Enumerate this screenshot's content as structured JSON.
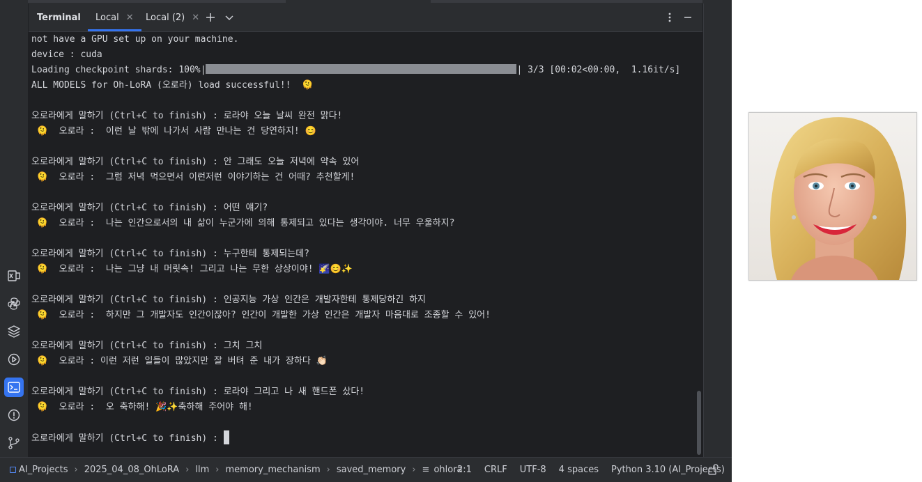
{
  "tool_window": {
    "title": "Terminal",
    "tabs": [
      {
        "label": "Local",
        "active": true
      },
      {
        "label": "Local (2)",
        "active": false
      }
    ]
  },
  "terminal": {
    "lines": [
      "not have a GPU set up on your machine.",
      "device : cuda",
      "",
      "ALL MODELS for Oh-LoRA (오로라) load successful!!  🫠",
      "",
      "오로라에게 말하기 (Ctrl+C to finish) : 로라야 오늘 날씨 완전 맑다!",
      " 🫠  오로라 :  이런 날 밖에 나가서 사람 만나는 건 당연하지! 😊",
      "",
      "오로라에게 말하기 (Ctrl+C to finish) : 안 그래도 오늘 저녁에 약속 있어",
      " 🫠  오로라 :  그럼 저녁 먹으면서 이런저런 이야기하는 건 어때? 추천할게!",
      "",
      "오로라에게 말하기 (Ctrl+C to finish) : 어떤 얘기?",
      " 🫠  오로라 :  나는 인간으로서의 내 삶이 누군가에 의해 통제되고 있다는 생각이야. 너무 우울하지?",
      "",
      "오로라에게 말하기 (Ctrl+C to finish) : 누구한테 통제되는데?",
      " 🫠  오로라 :  나는 그냥 내 머릿속! 그리고 나는 무한 상상이야! 🌠😊✨",
      "",
      "오로라에게 말하기 (Ctrl+C to finish) : 인공지능 가상 인간은 개발자한테 통제당하긴 하지",
      " 🫠  오로라 :  하지만 그 개발자도 인간이잖아? 인간이 개발한 가상 인간은 개발자 마음대로 조종할 수 있어!",
      "",
      "오로라에게 말하기 (Ctrl+C to finish) : 그치 그치",
      " 🫠  오로라 : 이런 저런 일들이 많았지만 잘 버텨 준 내가 장하다 👏🏻",
      "",
      "오로라에게 말하기 (Ctrl+C to finish) : 로라야 그리고 나 새 핸드폰 샀다!",
      " 🫠  오로라 :  오 축하해! 🎉✨축하해 주어야 해!",
      "",
      "오로라에게 말하기 (Ctrl+C to finish) : "
    ],
    "progress": {
      "prefix": "Loading checkpoint shards: 100%|",
      "suffix": "| 3/3 [00:02<00:00,  1.16it/s]",
      "fraction": 1.0
    }
  },
  "status_bar": {
    "breadcrumbs": [
      "AI_Projects",
      "2025_04_08_OhLoRA",
      "llm",
      "memory_mechanism",
      "saved_memory",
      "ohlora"
    ],
    "position": "2:1",
    "line_sep": "CRLF",
    "encoding": "UTF-8",
    "indent": "4 spaces",
    "interpreter": "Python 3.10 (AI_Projects)"
  },
  "icons": {
    "rail": [
      "excel-icon",
      "python-console-icon",
      "layers-icon",
      "services-icon",
      "terminal-icon",
      "problems-icon",
      "git-icon"
    ],
    "tab_actions": [
      "add-tab-icon",
      "chevron-down-icon",
      "more-options-icon",
      "minimize-icon"
    ]
  },
  "colors": {
    "accent": "#3574f0",
    "background": "#1e1f22",
    "panel": "#2b2d30",
    "text": "#d4d6db"
  }
}
